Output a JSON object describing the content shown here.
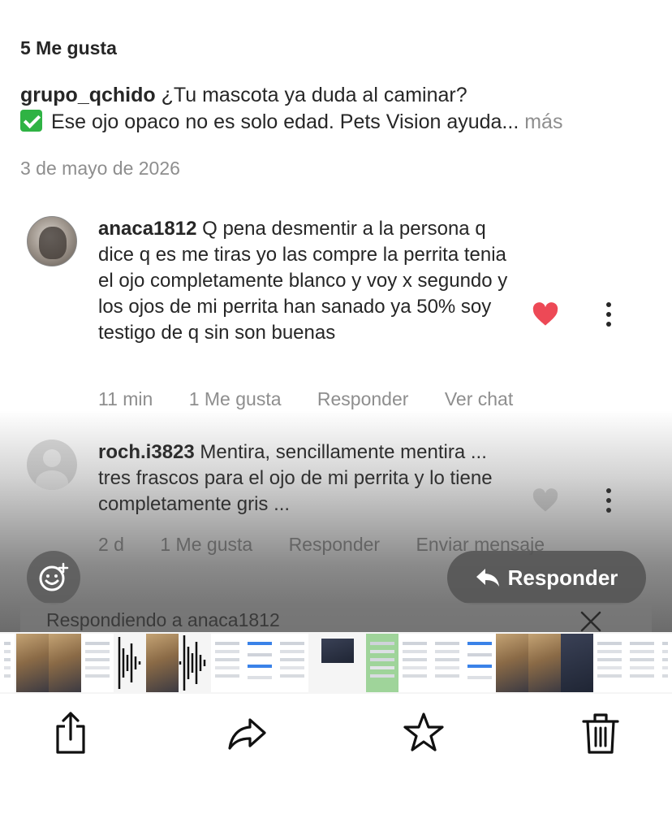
{
  "post": {
    "likes": "5 Me gusta",
    "caption_user": "grupo_qchido",
    "caption_line1": "¿Tu mascota ya duda al caminar?",
    "caption_line2": "Ese ojo opaco no es solo edad. Pets Vision ayuda...",
    "caption_more": "más",
    "date": "3 de mayo de 2026"
  },
  "comments": [
    {
      "user": "anaca1812",
      "text": "Q pena desmentir a la persona q dice q es me tiras yo las compre la perrita tenia el ojo completamente blanco y voy x segundo y los ojos de mi perrita han sanado ya 50% soy testigo de q sin son buenas",
      "time": "11 min",
      "likes": "1 Me gusta",
      "reply": "Responder",
      "extra": "Ver chat",
      "liked": true
    },
    {
      "user": "roch.i3823",
      "text": "Mentira, sencillamente mentira ... tres frascos para el ojo de mi perrita y lo tiene completamente gris ...",
      "time": "2 d",
      "likes": "1 Me gusta",
      "reply": "Responder",
      "extra": "Enviar mensaje",
      "liked": false
    }
  ],
  "overlay": {
    "reply_button": "Responder",
    "replying_to": "Respondiendo a anaca1812"
  },
  "toolbar": {
    "icons": [
      "share-icon",
      "forward-icon",
      "star-icon",
      "trash-icon"
    ]
  },
  "colors": {
    "heart_active": "#ed4956",
    "muted_text": "#8e8e8e",
    "check_green": "#2fb344"
  }
}
